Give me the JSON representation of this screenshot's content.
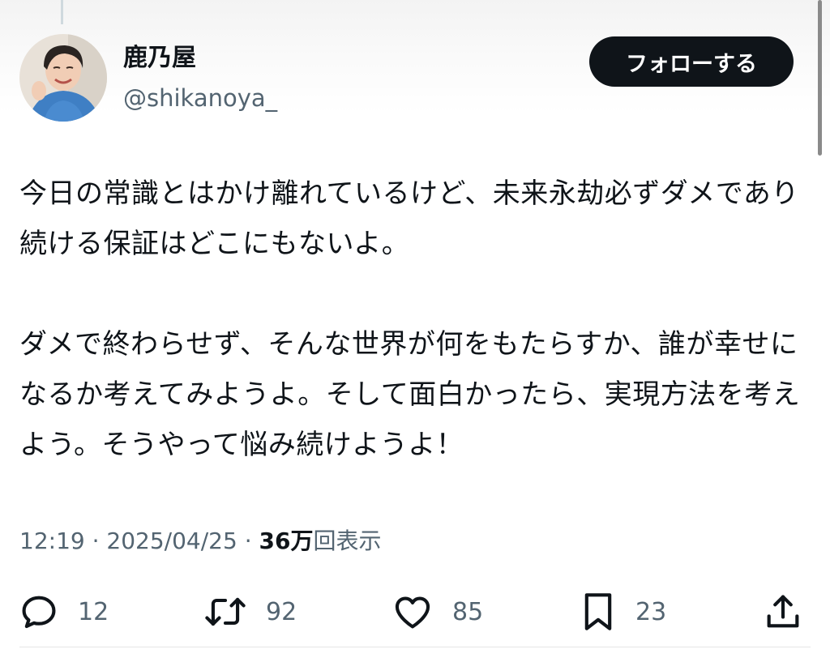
{
  "author": {
    "name": "鹿乃屋",
    "handle": "@shikanoya_"
  },
  "follow_button": {
    "label": "フォローする"
  },
  "tweet": {
    "text": "今日の常識とはかけ離れているけど、未来永劫必ずダメであり続ける保証はどこにもないよ。\n\nダメで終わらせず、そんな世界が何をもたらすか、誰が幸せになるか考えてみようよ。そして面白かったら、実現方法を考えよう。そうやって悩み続けようよ！"
  },
  "meta": {
    "time": "12:19",
    "separator": " · ",
    "date": "2025/04/25",
    "views_count": "36万",
    "views_label": "回表示"
  },
  "actions": {
    "replies": "12",
    "reposts": "92",
    "likes": "85",
    "bookmarks": "23"
  },
  "icons": {
    "reply": "reply-icon",
    "repost": "repost-icon",
    "like": "heart-icon",
    "bookmark": "bookmark-icon",
    "share": "share-icon"
  },
  "colors": {
    "text": "#0f1419",
    "secondary": "#536471",
    "follow_bg": "#0f1419"
  }
}
